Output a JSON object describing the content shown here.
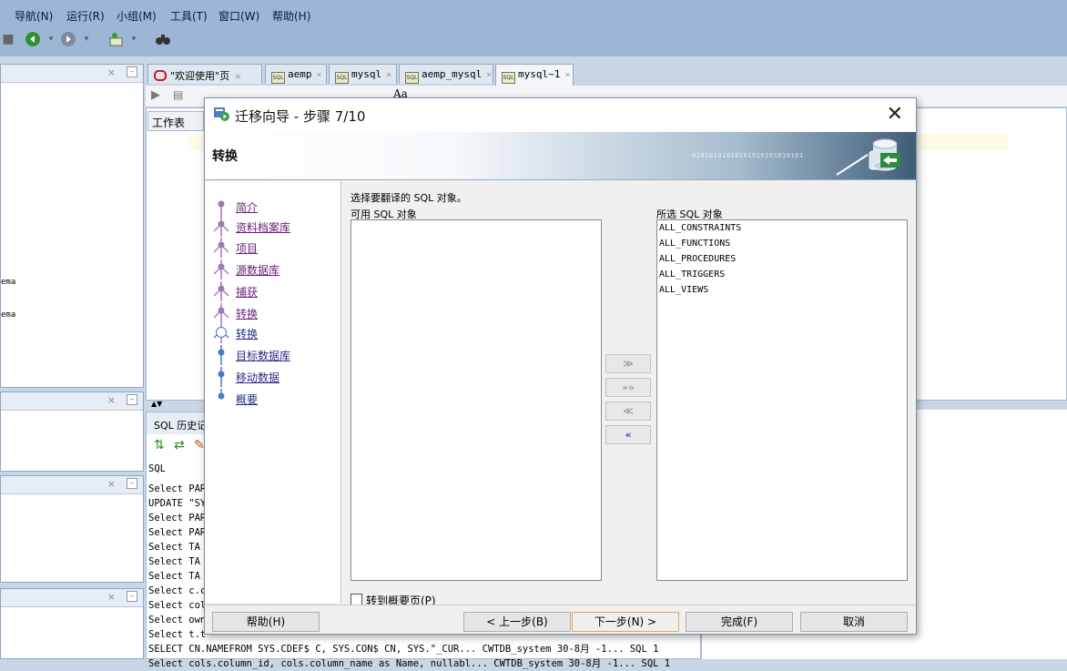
{
  "menubar": {
    "items": [
      "导航(N)",
      "运行(R)",
      "小组(M)",
      "工具(T)",
      "窗口(W)",
      "帮助(H)"
    ]
  },
  "left_panels": {
    "items": [
      "ema",
      "ema"
    ]
  },
  "editor_tabs": [
    {
      "label": "\"欢迎使用\"页",
      "icon": "oracle-icon"
    },
    {
      "label": "aemp",
      "icon": "sql-icon"
    },
    {
      "label": "mysql",
      "icon": "sql-icon"
    },
    {
      "label": "aemp_mysql",
      "icon": "sql-icon"
    },
    {
      "label": "mysql~1",
      "icon": "sql-icon",
      "active": true
    }
  ],
  "worksheet": {
    "tab_label": "工作表"
  },
  "sql_history": {
    "title": "SQL 历史记",
    "column_header": "SQL",
    "rows": [
      "Select PAR",
      "UPDATE \"SY",
      "Select PAR",
      "Select PAR",
      "Select  TA",
      "Select  TA",
      "Select  TA",
      "Select c.c",
      "Select col",
      "Select own",
      "Select t.t",
      "SELECT CN.NAMEFROM   SYS.CDEF$ C, SYS.CON$ CN, SYS.\"_CUR...  CWTDB_system 30-8月 -1...  SQL                         1",
      "Select cols.column_id, cols.column_name as Name, nullabl...  CWTDB_system 30-8月 -1...  SQL                         1"
    ]
  },
  "dialog": {
    "title": "迁移向导 - 步骤 7/10",
    "close_glyph": "✕",
    "banner_title": "转换",
    "banner_bits": "01010101010101010101010101",
    "steps": [
      {
        "label": "简介",
        "state": "visited"
      },
      {
        "label": "资料档案库",
        "state": "visited"
      },
      {
        "label": "项目",
        "state": "visited"
      },
      {
        "label": "源数据库",
        "state": "visited"
      },
      {
        "label": "捕获",
        "state": "visited"
      },
      {
        "label": "转换",
        "state": "visited"
      },
      {
        "label": "转换",
        "state": "current"
      },
      {
        "label": "目标数据库",
        "state": "todo"
      },
      {
        "label": "移动数据",
        "state": "todo"
      },
      {
        "label": "概要",
        "state": "todo"
      }
    ],
    "instruction": "选择要翻译的 SQL 对象。",
    "available_label": "可用 SQL 对象",
    "selected_label": "所选 SQL 对象",
    "available_items": [],
    "selected_items": [
      "ALL_CONSTRAINTS",
      "ALL_FUNCTIONS",
      "ALL_PROCEDURES",
      "ALL_TRIGGERS",
      "ALL_VIEWS"
    ],
    "move_buttons": [
      {
        "glyph": "≫",
        "name": "move-right-button"
      },
      {
        "glyph": "»»",
        "name": "move-all-right-button"
      },
      {
        "glyph": "≪",
        "name": "move-left-button"
      },
      {
        "glyph": "«",
        "name": "move-all-left-button"
      }
    ],
    "checkbox_label": "转到概要页(P)",
    "checkbox_checked": false,
    "buttons": {
      "help": "帮助(H)",
      "back": "< 上一步(B)",
      "next": "下一步(N) >",
      "finish": "完成(F)",
      "cancel": "取消"
    }
  }
}
